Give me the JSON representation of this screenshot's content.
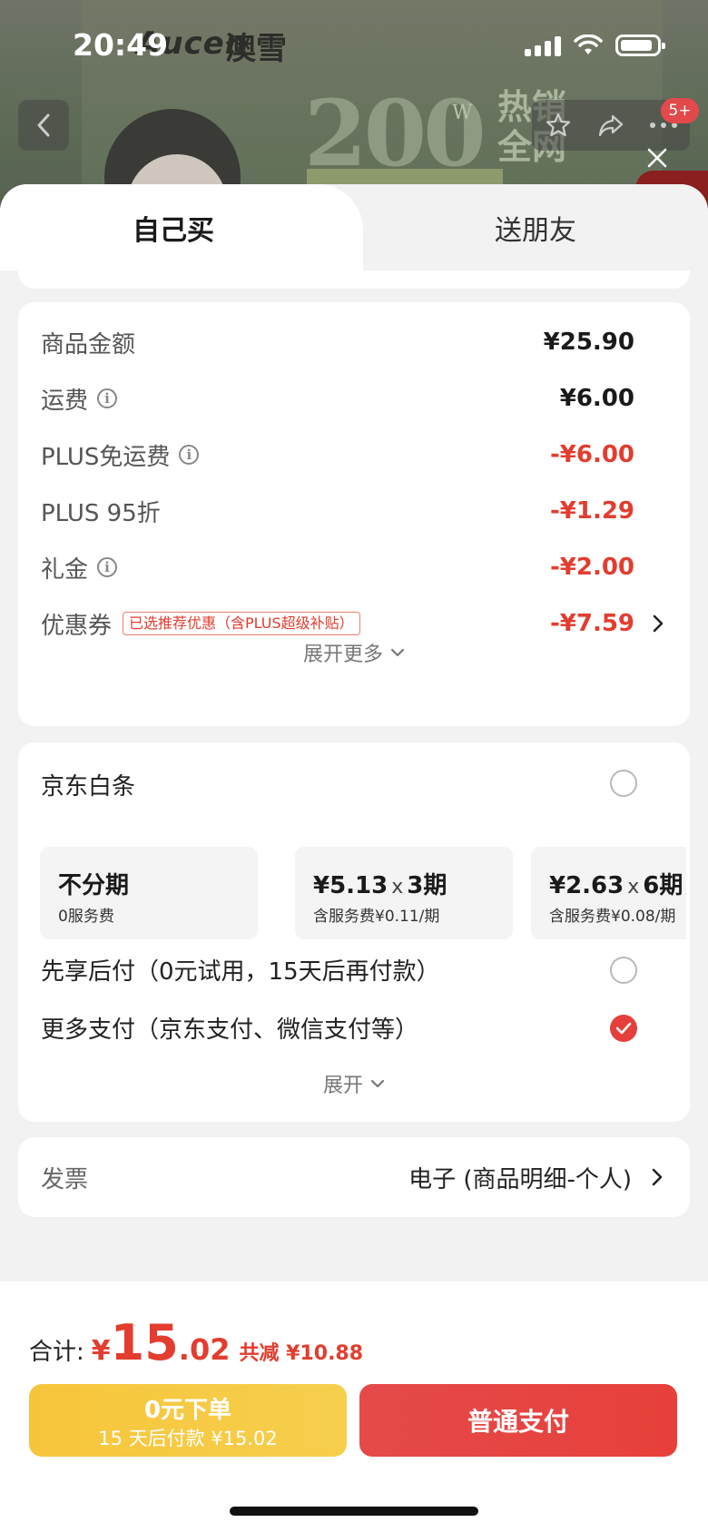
{
  "status_bar": {
    "time": "20:49"
  },
  "background": {
    "logo": "Aucen",
    "logo_cn": "澳雪",
    "promo_number": "200",
    "promo_w": "W",
    "promo_text": "热销\n全网",
    "badge": "5+"
  },
  "tabs": {
    "self_buy": "自己买",
    "gift": "送朋友"
  },
  "price_details": {
    "rows": [
      {
        "label": "商品金额",
        "value": "¥25.90"
      },
      {
        "label": "运费",
        "value": "¥6.00"
      },
      {
        "label": "PLUS免运费",
        "value": "-¥6.00"
      },
      {
        "label": "PLUS 95折",
        "value": "-¥1.29"
      },
      {
        "label": "礼金",
        "value": "-¥2.00"
      },
      {
        "label": "优惠券",
        "tag": "已选推荐优惠（含PLUS超级补贴）",
        "value": "-¥7.59"
      }
    ],
    "expand_label": "展开更多"
  },
  "payment": {
    "baitiao_label": "京东白条",
    "plans": [
      {
        "main": "不分期",
        "amount": "",
        "times": "",
        "sub": "0服务费"
      },
      {
        "main": "",
        "amount": "¥5.13",
        "times": "3期",
        "sub": "含服务费¥0.11/期"
      },
      {
        "main": "",
        "amount": "¥2.63",
        "times": "6期",
        "sub": "含服务费¥0.08/期"
      }
    ],
    "pay_later_label": "先享后付（0元试用，15天后再付款）",
    "more_payment_label": "更多支付（京东支付、微信支付等）",
    "expand_label": "展开"
  },
  "invoice": {
    "label": "发票",
    "value": "电子 (商品明细-个人)"
  },
  "total": {
    "label": "合计:",
    "currency": "¥",
    "integer": "15",
    "decimal": ".02",
    "saved": "共减 ¥10.88"
  },
  "buttons": {
    "pay_later_line1": "0元下单",
    "pay_later_line2": "15 天后付款 ¥15.02",
    "pay_now": "普通支付"
  },
  "colors": {
    "accent_red": "#e23d2f",
    "button_yellow": "#f7c53b",
    "button_red": "#e54a49"
  }
}
